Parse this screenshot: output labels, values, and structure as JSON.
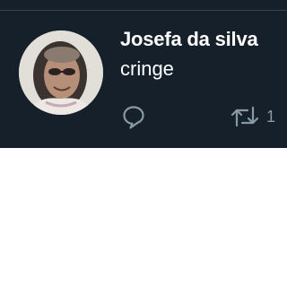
{
  "tweet": {
    "display_name": "Josefa da silva",
    "text": "cringe",
    "actions": {
      "reply_icon": "reply-icon",
      "retweet_icon": "retweet-icon",
      "retweet_count": "1"
    },
    "colors": {
      "background": "#15202b",
      "text": "#ffffff",
      "icon": "#8899a6",
      "divider": "#38444d"
    }
  }
}
